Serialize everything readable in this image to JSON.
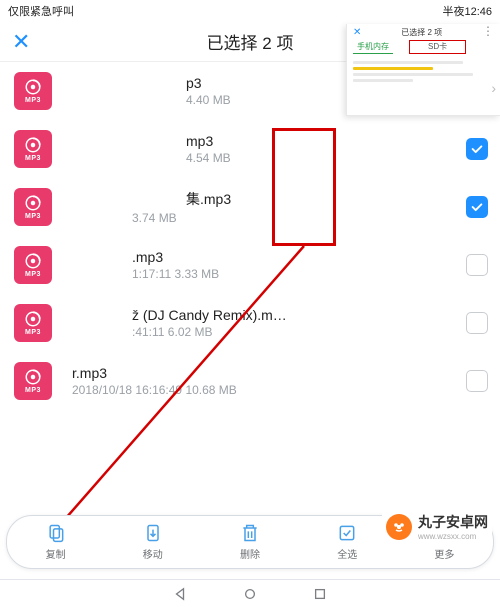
{
  "status": {
    "left": "仅限紧急呼叫",
    "time": "半夜12:46"
  },
  "header": {
    "title": "已选择 2 项"
  },
  "thumb_badge": "MP3",
  "files": [
    {
      "name": "p3",
      "sub": "4.40 MB",
      "checked": false
    },
    {
      "name": "mp3",
      "sub": "4.54 MB",
      "checked": true
    },
    {
      "name": "集.mp3",
      "sub": "              3.74 MB",
      "checked": true
    },
    {
      "name": ".mp3",
      "sub": "1:17:11 3.33 MB",
      "checked": false
    },
    {
      "name": "ž (DJ Candy Remix).m…",
      "sub": ":41:11 6.02 MB",
      "checked": false
    },
    {
      "name": "r.mp3",
      "sub": "2018/10/18 16:16:49 10.68 MB",
      "checked": false
    }
  ],
  "actions": {
    "copy": "复制",
    "move": "移动",
    "delete": "删除",
    "selectall": "全选",
    "more": "更多"
  },
  "inset": {
    "title": "已选择 2 项",
    "tab1": "手机内存",
    "tab2": "SD卡"
  },
  "watermark": {
    "name": "丸子安卓网",
    "url": "www.wzsxx.com"
  }
}
